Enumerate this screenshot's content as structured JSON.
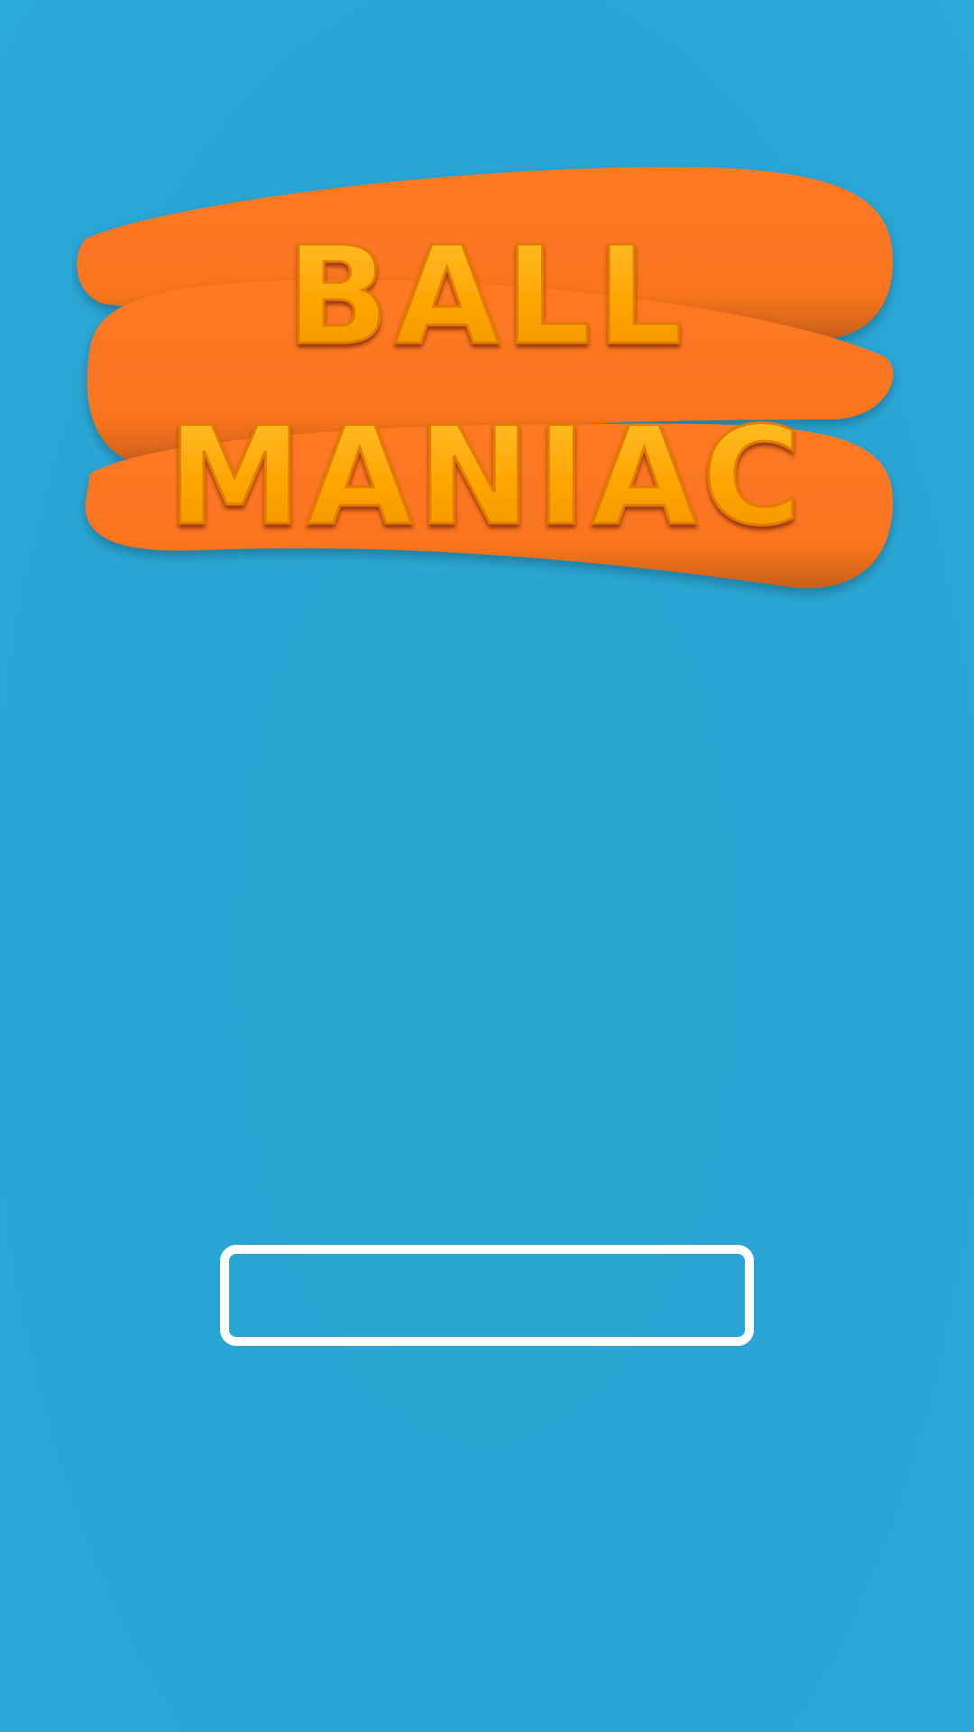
{
  "logo": {
    "line1": "BALL",
    "line2": "MANIAC",
    "colors": {
      "stroke_band": "#fb7520",
      "stroke_band_shade": "#d9621c",
      "text_fill": "#ffa705",
      "text_shadow": "#c24a10",
      "text_highlight": "#fff3c0"
    }
  },
  "loading_bar": {
    "progress": 0,
    "border_color": "#ffffff"
  },
  "colors": {
    "background": "#2aa6d2"
  }
}
